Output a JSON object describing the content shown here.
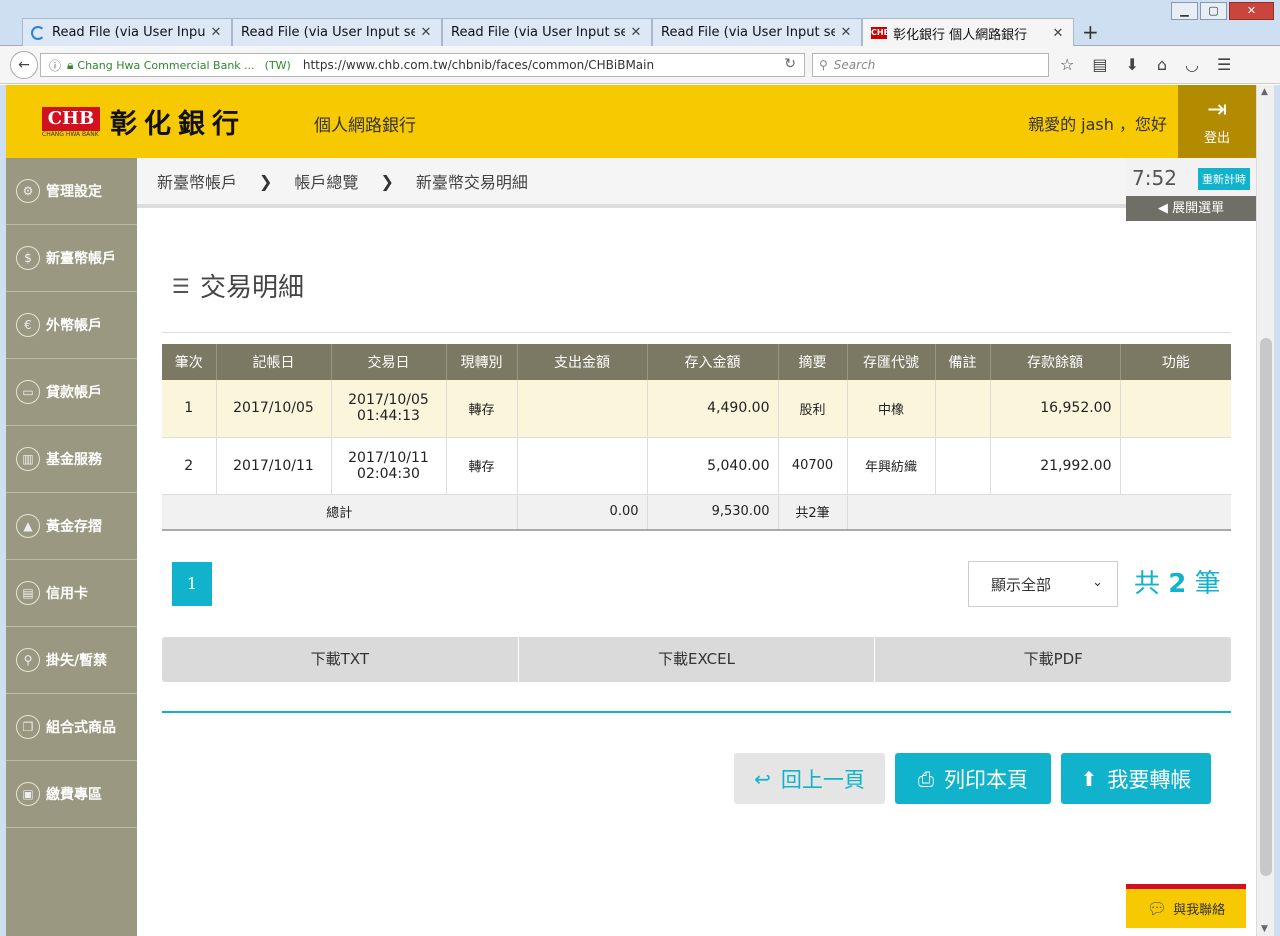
{
  "browser": {
    "tabs": [
      {
        "title": "Read File (via User Input sel"
      },
      {
        "title": "Read File (via User Input selecti"
      },
      {
        "title": "Read File (via User Input selecti"
      },
      {
        "title": "Read File (via User Input selecti"
      },
      {
        "title": "彰化銀行 個人網路銀行"
      }
    ],
    "fav_text": "CHB",
    "new_tab": "+",
    "url_identity": "Chang Hwa Commercial Bank ...",
    "url_country": "(TW)",
    "url": "https://www.chb.com.tw/chbnib/faces/common/CHBiBMain",
    "search_placeholder": "Search"
  },
  "header": {
    "logo_text": "CHB",
    "logo_sub": "CHANG HWA BANK",
    "bank_name": "彰化銀行",
    "service_name": "個人網路銀行",
    "greeting": "親愛的 jash ，您好",
    "logout": "登出"
  },
  "sidebar": {
    "items": [
      {
        "label": "管理設定",
        "icon": "gear-icon",
        "glyph": "⚙"
      },
      {
        "label": "新臺幣帳戶",
        "icon": "dollar-icon",
        "glyph": "$"
      },
      {
        "label": "外幣帳戶",
        "icon": "euro-icon",
        "glyph": "€"
      },
      {
        "label": "貸款帳戶",
        "icon": "banknote-icon",
        "glyph": "▭"
      },
      {
        "label": "基金服務",
        "icon": "bar-chart-icon",
        "glyph": "▥"
      },
      {
        "label": "黃金存摺",
        "icon": "gold-bars-icon",
        "glyph": "▲"
      },
      {
        "label": "信用卡",
        "icon": "credit-card-icon",
        "glyph": "▤"
      },
      {
        "label": "掛失/暫禁",
        "icon": "search-icon",
        "glyph": "⚲"
      },
      {
        "label": "組合式商品",
        "icon": "stack-icon",
        "glyph": "❐"
      },
      {
        "label": "繳費專區",
        "icon": "wallet-icon",
        "glyph": "▣"
      }
    ]
  },
  "breadcrumb": {
    "items": [
      "新臺幣帳戶",
      "帳戶總覽",
      "新臺幣交易明細"
    ],
    "separator": "❯"
  },
  "session": {
    "time": "7:52",
    "reset": "重新計時",
    "expand_menu": "展開選單"
  },
  "main": {
    "title": "交易明細",
    "table": {
      "headers": [
        "筆次",
        "記帳日",
        "交易日",
        "現轉別",
        "支出金額",
        "存入金額",
        "摘要",
        "存匯代號",
        "備註",
        "存款餘額",
        "功能"
      ],
      "rows": [
        {
          "no": "1",
          "post_date": "2017/10/05",
          "tx_date": "2017/10/05",
          "tx_time": "01:44:13",
          "type": "轉存",
          "withdraw": "",
          "deposit": "4,490.00",
          "memo": "股利",
          "code": "中橡",
          "note": "",
          "balance": "16,952.00",
          "action": ""
        },
        {
          "no": "2",
          "post_date": "2017/10/11",
          "tx_date": "2017/10/11",
          "tx_time": "02:04:30",
          "type": "轉存",
          "withdraw": "",
          "deposit": "5,040.00",
          "memo": "40700",
          "code": "年興紡織",
          "note": "",
          "balance": "21,992.00",
          "action": ""
        }
      ],
      "total": {
        "label": "總計",
        "withdraw": "0.00",
        "deposit": "9,530.00",
        "count": "共2筆"
      }
    },
    "pager": {
      "current": "1"
    },
    "display_select": "顯示全部",
    "record_count": {
      "prefix": "共",
      "count": "2",
      "suffix": "筆"
    },
    "downloads": [
      "下載TXT",
      "下載EXCEL",
      "下載PDF"
    ],
    "actions": {
      "back": "回上一頁",
      "print": "列印本頁",
      "transfer": "我要轉帳"
    }
  },
  "contact": "與我聯絡",
  "colors": {
    "brand_yellow": "#f7c900",
    "accent_cyan": "#11b3cc",
    "sidebar": "#9a9880",
    "table_header": "#7b7863"
  }
}
